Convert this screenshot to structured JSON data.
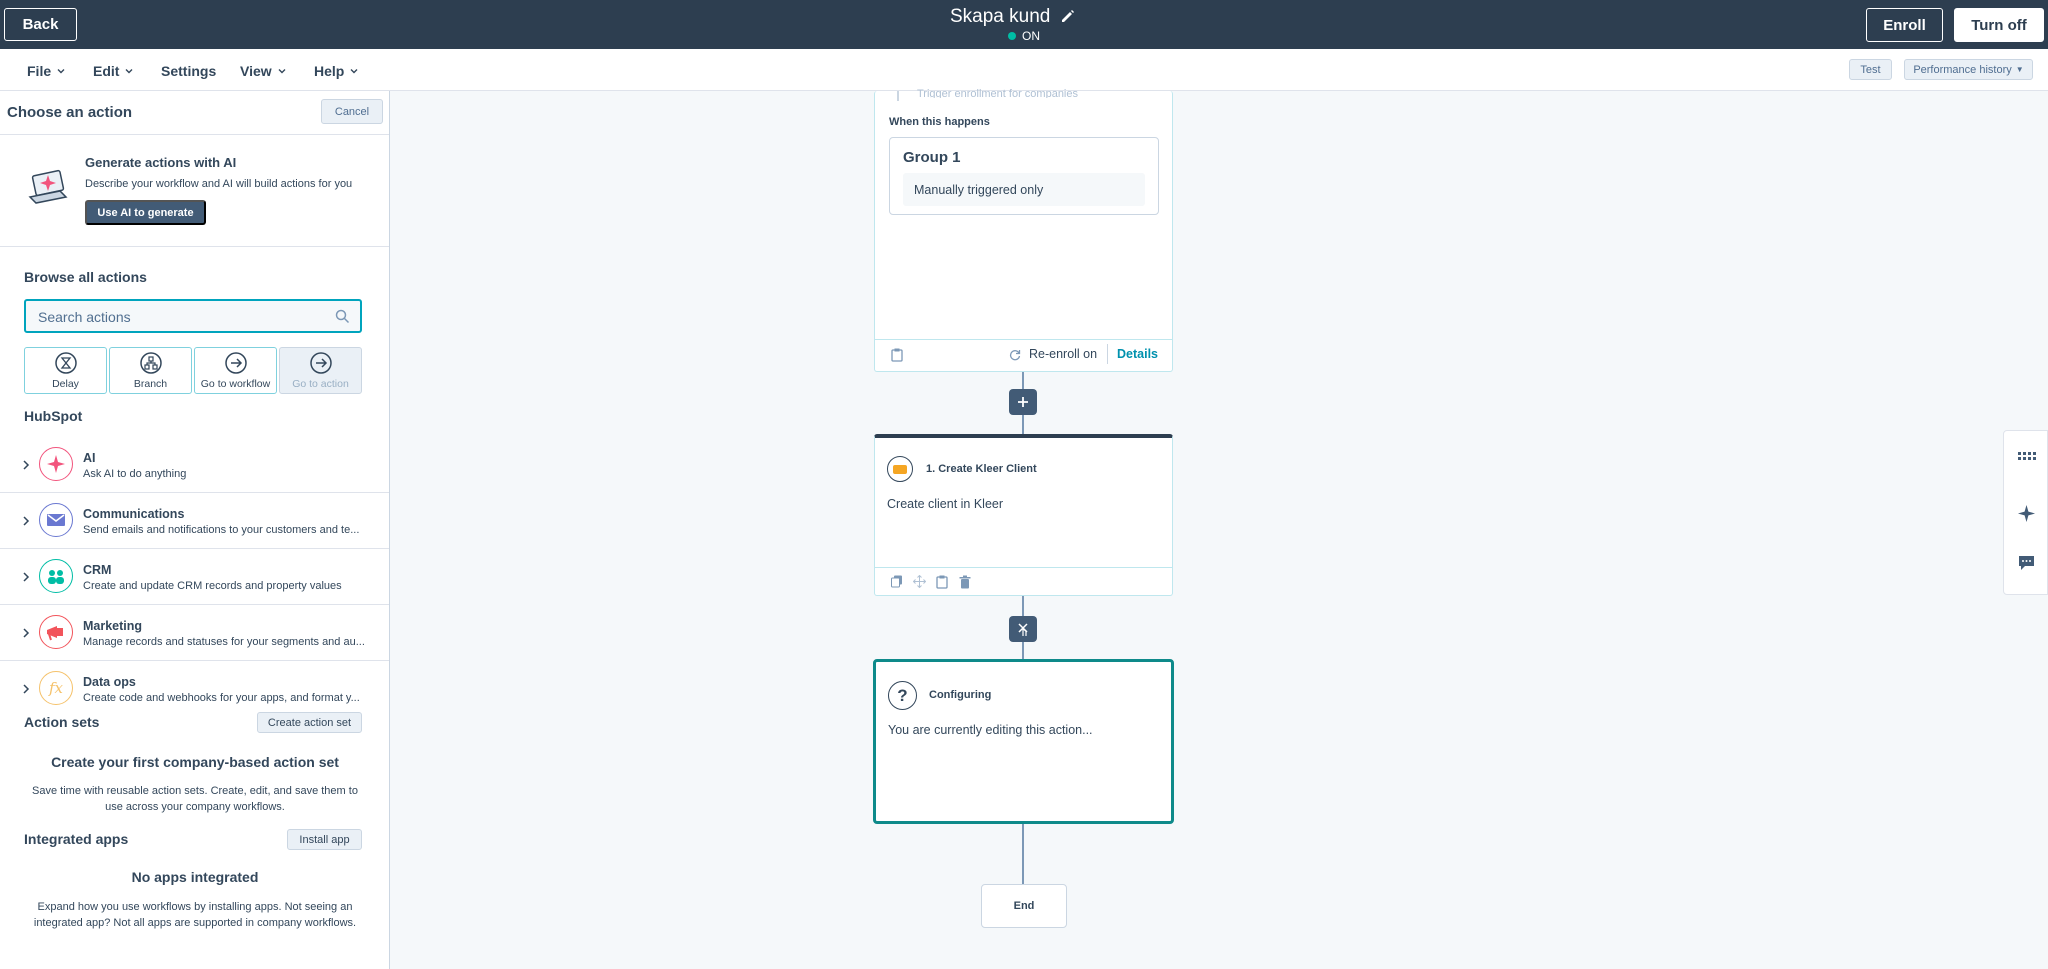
{
  "topbar": {
    "back_label": "Back",
    "workflow_name": "Skapa kund",
    "status": "ON",
    "enroll_label": "Enroll",
    "turn_off_label": "Turn off"
  },
  "menubar": {
    "items": [
      "File",
      "Edit",
      "Settings",
      "View",
      "Help"
    ],
    "test_label": "Test",
    "performance_label": "Performance history"
  },
  "panel": {
    "title": "Choose an action",
    "cancel_label": "Cancel",
    "ai": {
      "title": "Generate actions with AI",
      "description": "Describe your workflow and AI will build actions for you",
      "button": "Use AI to generate"
    },
    "browse_title": "Browse all actions",
    "search_placeholder": "Search actions",
    "quick_actions": [
      "Delay",
      "Branch",
      "Go to workflow",
      "Go to action"
    ],
    "hubspot_title": "HubSpot",
    "categories": [
      {
        "title": "AI",
        "desc": "Ask AI to do anything",
        "color": "#f2547d"
      },
      {
        "title": "Communications",
        "desc": "Send emails and notifications to your customers and te...",
        "color": "#6a78d1"
      },
      {
        "title": "CRM",
        "desc": "Create and update CRM records and property values",
        "color": "#00bda5"
      },
      {
        "title": "Marketing",
        "desc": "Manage records and statuses for your segments and au...",
        "color": "#f2545b"
      },
      {
        "title": "Data ops",
        "desc": "Create code and webhooks for your apps, and format y...",
        "color": "#f5c26b"
      }
    ],
    "action_sets_title": "Action sets",
    "create_action_set_label": "Create action set",
    "action_sets_empty_title": "Create your first company-based action set",
    "action_sets_empty_desc": "Save time with reusable action sets. Create, edit, and save them to use across your company workflows.",
    "integrated_title": "Integrated apps",
    "install_app_label": "Install app",
    "apps_empty_title": "No apps integrated",
    "apps_empty_desc": "Expand how you use workflows by installing apps. Not seeing an integrated app? Not all apps are supported in company workflows."
  },
  "canvas": {
    "trigger": {
      "faded_text": "Trigger enrollment for companies",
      "when_label": "When this happens",
      "group_title": "Group 1",
      "group_condition": "Manually triggered only",
      "reenroll_label": "Re-enroll on",
      "details_label": "Details"
    },
    "action1": {
      "title": "1. Create Kleer Client",
      "desc": "Create client in Kleer"
    },
    "configuring": {
      "title": "Configuring",
      "desc": "You are currently editing this action..."
    },
    "end_label": "End"
  },
  "colors": {
    "topbar": "#2d3e50",
    "accent": "#00a4bd",
    "selected_border": "#0e8a8a",
    "status_on": "#00bda5"
  }
}
